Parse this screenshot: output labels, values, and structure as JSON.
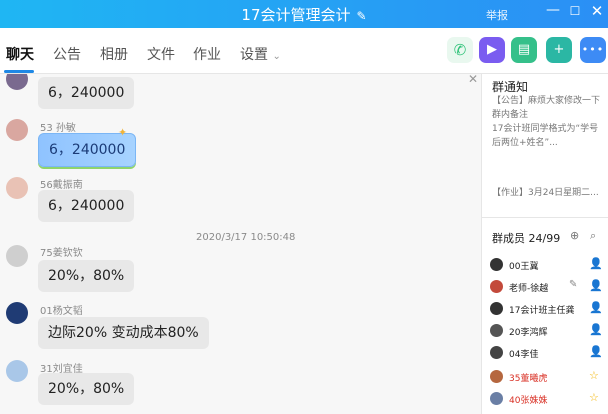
{
  "window": {
    "title": "17会计管理会计",
    "report_label": "举报",
    "icons": {
      "edit": "pencil-icon",
      "minimize": "minimize-icon",
      "maximize": "maximize-icon",
      "close": "close-icon"
    }
  },
  "tabs": [
    {
      "label": "聊天",
      "active": true
    },
    {
      "label": "公告"
    },
    {
      "label": "相册"
    },
    {
      "label": "文件"
    },
    {
      "label": "作业"
    },
    {
      "label": "设置"
    }
  ],
  "actions": [
    {
      "icon": "phone-icon",
      "color": "#2ec278"
    },
    {
      "icon": "video-icon",
      "color": "#7a5cf0"
    },
    {
      "icon": "screen-share-icon",
      "color": "#35c08a"
    },
    {
      "icon": "add-app-icon",
      "color": "#2bb7a4"
    },
    {
      "icon": "more-icon",
      "color": "#3d8bf5"
    }
  ],
  "messages": [
    {
      "sender": "",
      "text": "6，240000"
    },
    {
      "sender": "53 孙敏",
      "text": "6，240000"
    },
    {
      "sender": "56戴振南",
      "text": "6，240000"
    },
    {
      "sender": "75姜钦钦",
      "text": "20%，80%"
    },
    {
      "sender": "01杨文韬",
      "text": "边际20% 变动成本80%"
    },
    {
      "sender": "31刘宜佳",
      "text": "20%，80%"
    }
  ],
  "timestamp": "2020/3/17 10:50:48",
  "notice": {
    "title": "群通知",
    "body": "【公告】麻烦大家修改一下群内备注\n17会计班同学格式为“学号后两位+姓名”...",
    "homework": "【作业】3月24日星期二..."
  },
  "members": {
    "title": "群成员 24/99",
    "list": [
      {
        "name": "00王冀",
        "color": "#222",
        "role_icon": "member-icon"
      },
      {
        "name": "老师-徐越",
        "color": "#222",
        "role_icon": "member-icon"
      },
      {
        "name": "17会计班主任龚",
        "color": "#222",
        "role_icon": "member-icon"
      },
      {
        "name": "20李鸿辉",
        "color": "#222",
        "role_icon": "member-icon"
      },
      {
        "name": "04李佳",
        "color": "#222",
        "role_icon": "member-icon"
      },
      {
        "name": "35董曦虎",
        "color": "#d93025",
        "role_icon": "star-icon"
      },
      {
        "name": "40张姝姝",
        "color": "#d93025",
        "role_icon": "star-icon"
      }
    ]
  }
}
